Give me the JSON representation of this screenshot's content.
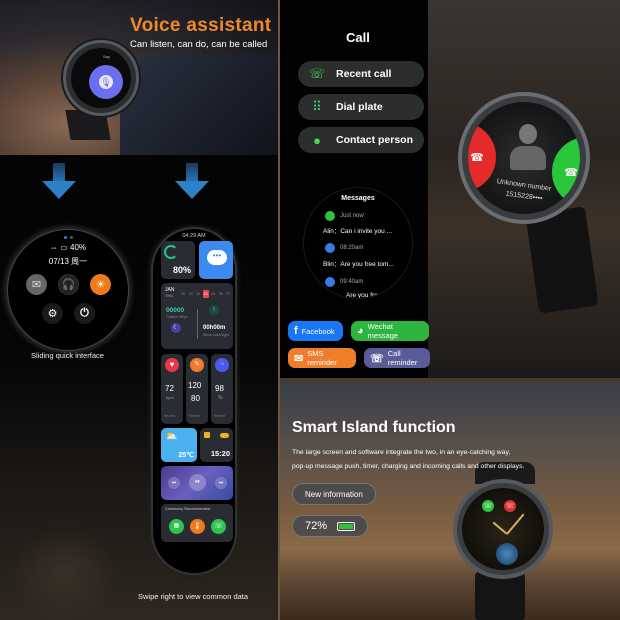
{
  "voice": {
    "title": "Voice assistant",
    "subtitle": "Can listen, can do, can be called",
    "screen_label": "Say",
    "mic_icon": "microphone-icon"
  },
  "quick_interface": {
    "status": "⇔ ▭ 40%",
    "date": "07/13 周一",
    "buttons": [
      {
        "name": "message",
        "icon": "✉",
        "color": "#6a6a6a"
      },
      {
        "name": "headphones",
        "icon": "🎧",
        "color": "#2a2a2a"
      },
      {
        "name": "brightness",
        "icon": "☀",
        "color": "#f07a1a"
      },
      {
        "name": "settings",
        "icon": "⚙",
        "color": "#1a1a1a"
      },
      {
        "name": "power",
        "icon": "⏻",
        "color": "#1a1a1a"
      }
    ],
    "caption": "Sliding quick interface"
  },
  "phone_screen": {
    "time": "04:29 AM",
    "battery": "80%",
    "calendar_month": "JAN",
    "calendar_day": "THU",
    "calendar_dates": [
      "20",
      "22",
      "23",
      "24",
      "25",
      "26",
      "27"
    ],
    "calendar_selected": "24",
    "steps_value": "00000",
    "steps_label": "Today's Steps",
    "sleep_value": "00h00m",
    "sleep_label": "Sleep Last Night",
    "heart_rate": "72",
    "heart_unit": "bpm",
    "bp_high": "120",
    "bp_low": "80",
    "spo2": "98",
    "spo2_unit": "%",
    "recent_label": "Recent",
    "weather_temp": "25℃",
    "clock": "15:20",
    "recommended_label": "Commonly Recommended",
    "caption": "Swipe right to view common data"
  },
  "call": {
    "title": "Call",
    "buttons": [
      {
        "label": "Recent call",
        "icon": "☏"
      },
      {
        "label": "Dial plate",
        "icon": "⠿"
      },
      {
        "label": "Contact person",
        "icon": "👤"
      }
    ]
  },
  "messages": {
    "title": "Messages",
    "items": [
      {
        "time": "Just now",
        "text": "Alin：Can i invite you ...",
        "color": "#2ec440"
      },
      {
        "time": "08:20am",
        "text": "Blin：Are you free tom...",
        "color": "#3a7be0"
      },
      {
        "time": "09:40am",
        "text": "Are you fre...",
        "color": "#3a7be0"
      }
    ]
  },
  "apps": [
    {
      "label": "Facebook",
      "icon": "f",
      "color": "#1877f2"
    },
    {
      "label": "Wechat message",
      "icon": "◕",
      "color": "#2db53d"
    },
    {
      "label": "SMS reminder",
      "icon": "✉",
      "color": "#f07d2a"
    },
    {
      "label": "Call reminder",
      "icon": "☏",
      "color": "#5a5c9a"
    }
  ],
  "incoming_call": {
    "caller": "Unknown number",
    "number": "1515228••••"
  },
  "smart_island": {
    "title": "Smart Island function",
    "description_line1": "The large screen and software integrate the two, in an eye-catching way,",
    "description_line2": "pop-up message push, timer, charging and incoming calls and other displays.",
    "pill_new_info": "New information",
    "pill_battery": "72%"
  }
}
